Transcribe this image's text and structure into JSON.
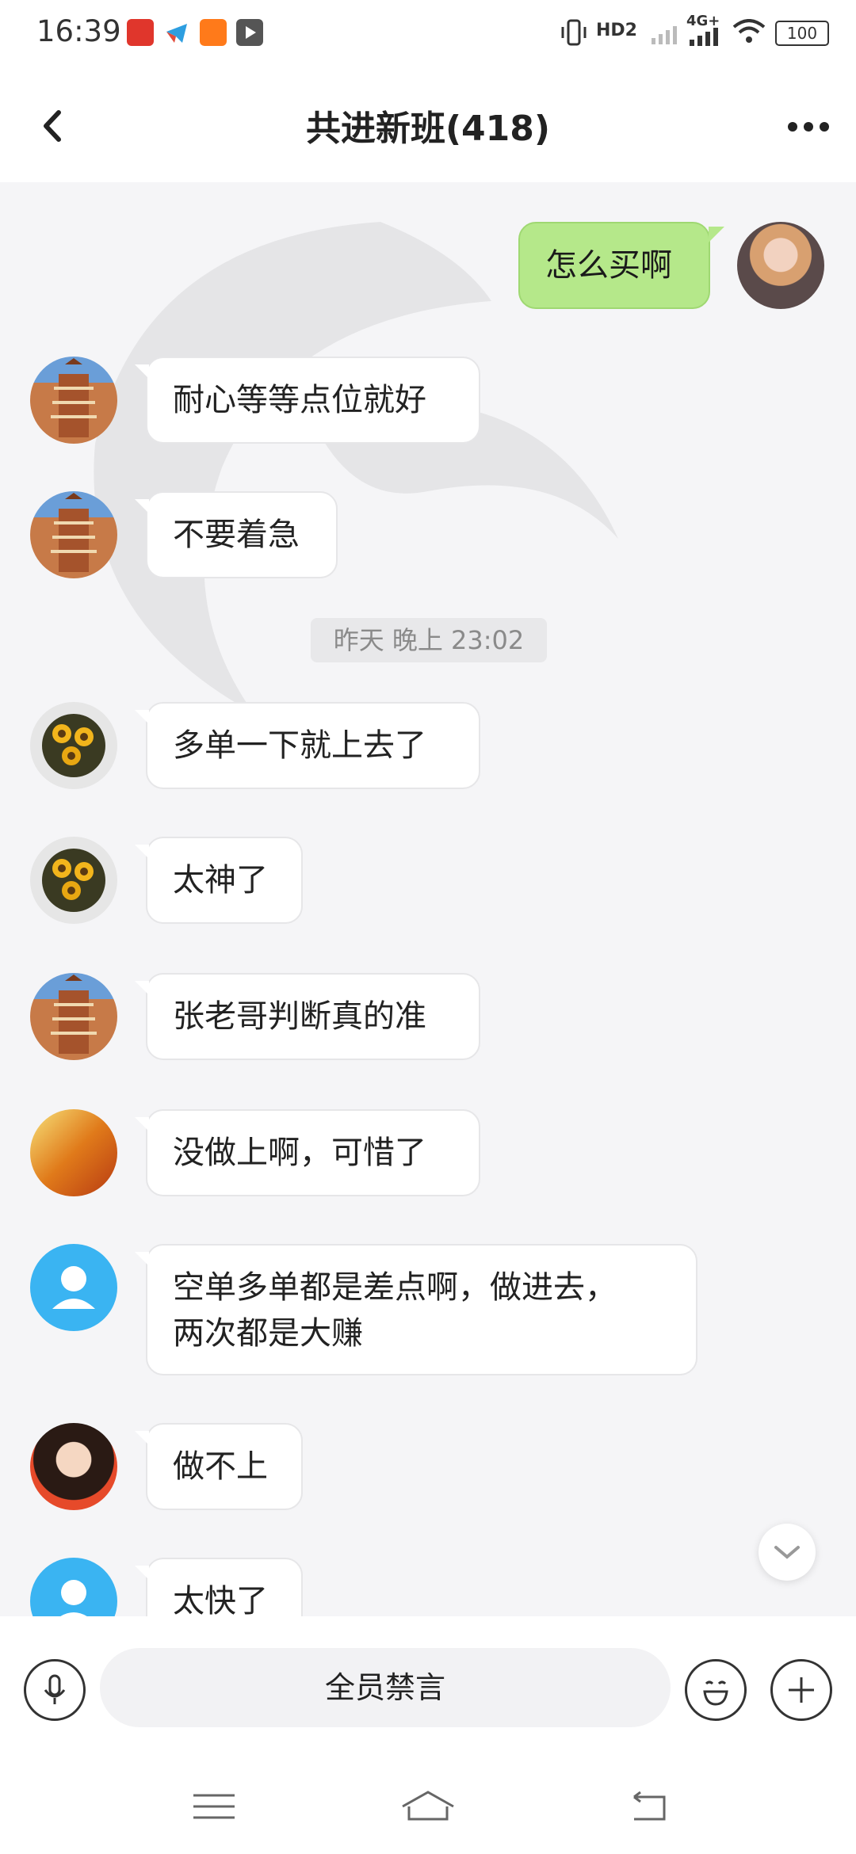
{
  "status_bar": {
    "time": "16:39",
    "network": "4G+",
    "hd": "HD2",
    "battery": "100"
  },
  "header": {
    "title": "共进新班(418)"
  },
  "messages": [
    {
      "text": "怎么买啊",
      "direction": "out"
    },
    {
      "text": "耐心等等点位就好",
      "direction": "in"
    },
    {
      "text": "不要着急",
      "direction": "in"
    },
    {
      "text": "多单一下就上去了",
      "direction": "in"
    },
    {
      "text": "太神了",
      "direction": "in"
    },
    {
      "text": "张老哥判断真的准",
      "direction": "in"
    },
    {
      "text": "没做上啊，可惜了",
      "direction": "in"
    },
    {
      "text": "空单多单都是差点啊，做进去，\n两次都是大赚",
      "direction": "in"
    },
    {
      "text": "做不上",
      "direction": "in"
    },
    {
      "text": "太快了",
      "direction": "in"
    }
  ],
  "timestamp": "昨天 晚上 23:02",
  "input": {
    "mute_text": "全员禁言"
  },
  "colors": {
    "outgoing_bubble": "#b5e88a",
    "incoming_bubble": "#ffffff",
    "background": "#f5f5f7",
    "default_avatar": "#3ab4f2"
  },
  "icons": [
    "back-icon",
    "more-icon",
    "mic-icon",
    "emoji-icon",
    "plus-icon",
    "chevron-down-icon",
    "menu-icon",
    "home-icon",
    "back-nav-icon"
  ]
}
